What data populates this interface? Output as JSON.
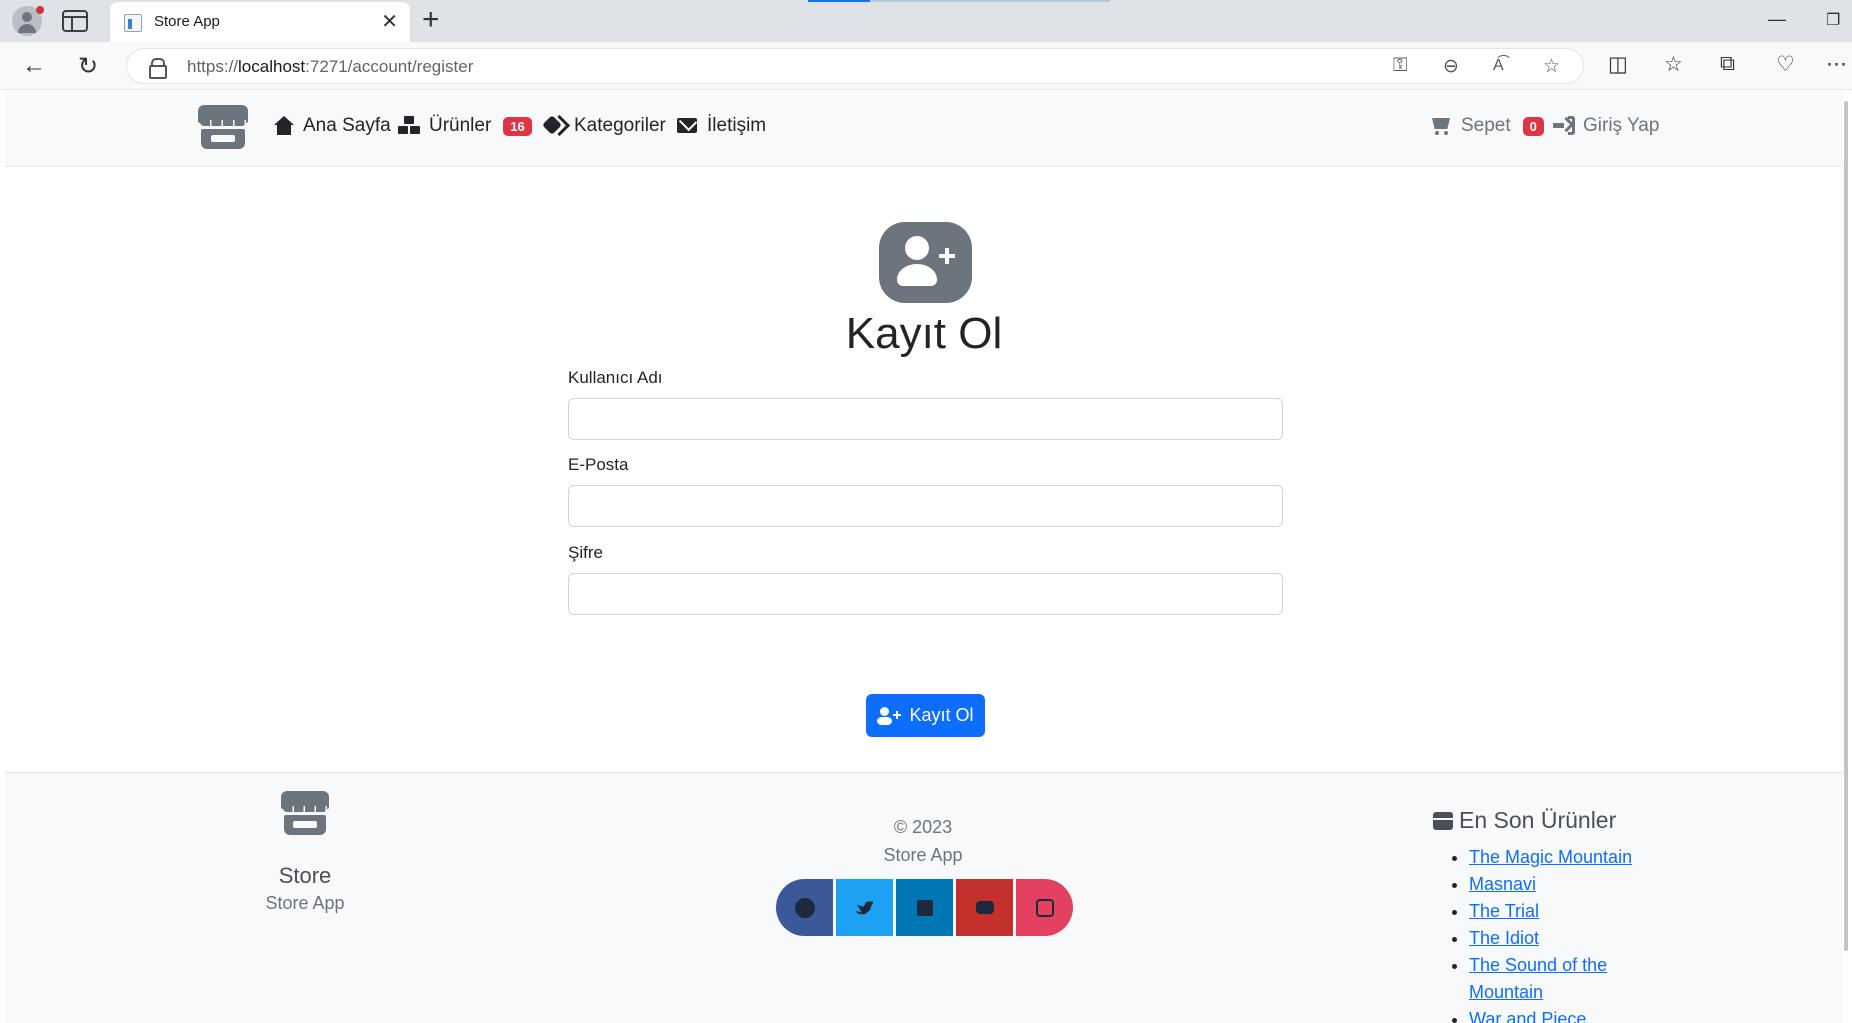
{
  "browser": {
    "tab_title": "Store App",
    "url_prefix": "https://",
    "url_host": "localhost",
    "url_rest": ":7271/account/register"
  },
  "navbar": {
    "home": "Ana Sayfa",
    "products": "Ürünler",
    "products_count": "16",
    "categories": "Kategoriler",
    "contact": "İletişim",
    "cart": "Sepet",
    "cart_count": "0",
    "login": "Giriş Yap"
  },
  "register": {
    "title": "Kayıt Ol",
    "username_label": "Kullanıcı Adı",
    "email_label": "E-Posta",
    "password_label": "Şifre",
    "submit_label": "Kayıt Ol"
  },
  "footer": {
    "brand": "Store",
    "brand_sub": "Store App",
    "copyright": "© 2023",
    "copyright_sub": "Store App",
    "latest_title": "En Son Ürünler",
    "latest_items": [
      "The Magic Mountain",
      "Masnavi",
      "The Trial",
      "The Idiot",
      "The Sound of the Mountain",
      "War and Piece"
    ],
    "social": [
      {
        "name": "facebook-icon",
        "color": "#3b5998"
      },
      {
        "name": "twitter-icon",
        "color": "#1da1f2"
      },
      {
        "name": "linkedin-icon",
        "color": "#0077b5"
      },
      {
        "name": "youtube-icon",
        "color": "#c4302b"
      },
      {
        "name": "instagram-icon",
        "color": "#e4405f"
      }
    ]
  },
  "colors": {
    "primary": "#0d6efd",
    "danger": "#dc3545",
    "secondary": "#6c757d"
  }
}
